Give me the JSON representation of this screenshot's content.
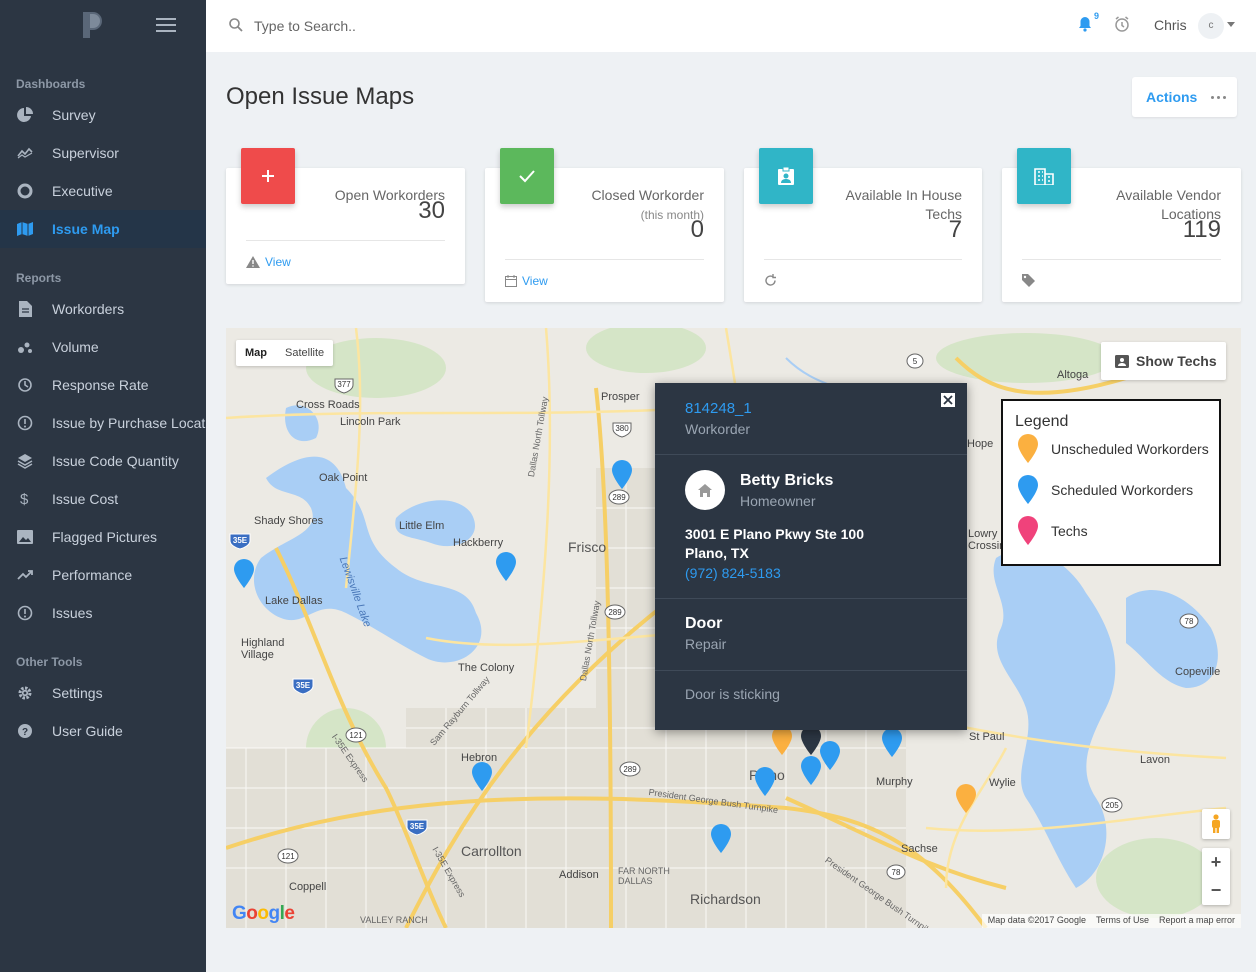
{
  "sidebar": {
    "sections": [
      {
        "title": "Dashboards",
        "items": [
          {
            "label": "Survey",
            "icon": "pie-chart-icon"
          },
          {
            "label": "Supervisor",
            "icon": "trend-line-icon"
          },
          {
            "label": "Executive",
            "icon": "donut-chart-icon"
          },
          {
            "label": "Issue Map",
            "icon": "map-icon",
            "active": true
          }
        ]
      },
      {
        "title": "Reports",
        "items": [
          {
            "label": "Workorders",
            "icon": "document-icon"
          },
          {
            "label": "Volume",
            "icon": "scatter-icon"
          },
          {
            "label": "Response Rate",
            "icon": "history-icon"
          },
          {
            "label": "Issue by Purchase Location",
            "icon": "info-circle-icon"
          },
          {
            "label": "Issue Code Quantity",
            "icon": "layers-icon"
          },
          {
            "label": "Issue Cost",
            "icon": "dollar-icon"
          },
          {
            "label": "Flagged Pictures",
            "icon": "image-icon"
          },
          {
            "label": "Performance",
            "icon": "trend-up-icon"
          },
          {
            "label": "Issues",
            "icon": "info-circle-icon"
          }
        ]
      },
      {
        "title": "Other Tools",
        "items": [
          {
            "label": "Settings",
            "icon": "gear-icon"
          },
          {
            "label": "User Guide",
            "icon": "help-circle-icon"
          }
        ]
      }
    ]
  },
  "topbar": {
    "search_placeholder": "Type to Search..",
    "notification_count": "9",
    "user_name": "Chris",
    "user_initial": "c"
  },
  "page": {
    "title": "Open Issue Maps",
    "actions_label": "Actions"
  },
  "cards": [
    {
      "label": "Open Workorders",
      "sub": "",
      "value": "30",
      "link": "View",
      "icon_color": "#ef4b4b",
      "icon": "plus-icon",
      "foot_icon": "warning-icon"
    },
    {
      "label": "Closed Workorder",
      "sub": "(this month)",
      "value": "0",
      "link": "View",
      "icon_color": "#5cb85c",
      "icon": "check-icon",
      "foot_icon": "calendar-icon"
    },
    {
      "label": "Available In House Techs",
      "sub": "",
      "value": "7",
      "link": "",
      "icon_color": "#30b5c7",
      "icon": "badge-icon",
      "foot_icon": "refresh-icon"
    },
    {
      "label": "Available Vendor Locations",
      "sub": "",
      "value": "119",
      "link": "",
      "icon_color": "#30b5c7",
      "icon": "building-icon",
      "foot_icon": "tag-icon"
    }
  ],
  "card_label_lines": [
    [
      "Open Workorders"
    ],
    [
      "Closed Workorder"
    ],
    [
      "Available In House",
      "Techs"
    ],
    [
      "Available Vendor",
      "Locations"
    ]
  ],
  "map": {
    "type_map": "Map",
    "type_satellite": "Satellite",
    "show_techs": "Show Techs",
    "legend": {
      "title": "Legend",
      "items": [
        {
          "label": "Unscheduled Workorders",
          "color": "#fbb040"
        },
        {
          "label": "Scheduled Workorders",
          "color": "#2e9bf0"
        },
        {
          "label": "Techs",
          "color": "#f0427b"
        }
      ]
    },
    "places": [
      "Prosper",
      "Cross Roads",
      "Lincoln Park",
      "Oak Point",
      "Shady Shores",
      "Little Elm",
      "Hackberry",
      "Frisco",
      "Lake Dallas",
      "Highland Village",
      "The Colony",
      "Hebron",
      "Carrollton",
      "Addison",
      "Richardson",
      "Coppell",
      "Plano",
      "Murphy",
      "Wylie",
      "Sachse",
      "St Paul",
      "Lavon",
      "Copeville",
      "Altoga",
      "Hope",
      "Lowry Crossing",
      "Lewisville Lake",
      "FAR NORTH DALLAS",
      "VALLEY RANCH",
      "Dallas North Tollway",
      "Sam Rayburn Tollway",
      "President George Bush Turnpike",
      "I-35E Express"
    ],
    "highways": [
      "377",
      "380",
      "289",
      "35E",
      "121",
      "5",
      "78",
      "205"
    ],
    "footer": [
      "Map data ©2017 Google",
      "Terms of Use",
      "Report a map error"
    ]
  },
  "popup": {
    "id": "814248_1",
    "type": "Workorder",
    "name": "Betty Bricks",
    "role": "Homeowner",
    "address1": "3001 E Plano Pkwy Ste 100",
    "address2": "Plano, TX",
    "phone": "(972) 824-5183",
    "item": "Door",
    "item_type": "Repair",
    "description": "Door is sticking"
  },
  "colors": {
    "sidebar_bg": "#2c3643",
    "accent": "#2e9bf0",
    "unscheduled": "#fbb040",
    "scheduled": "#2e9bf0",
    "techs": "#f0427b"
  }
}
